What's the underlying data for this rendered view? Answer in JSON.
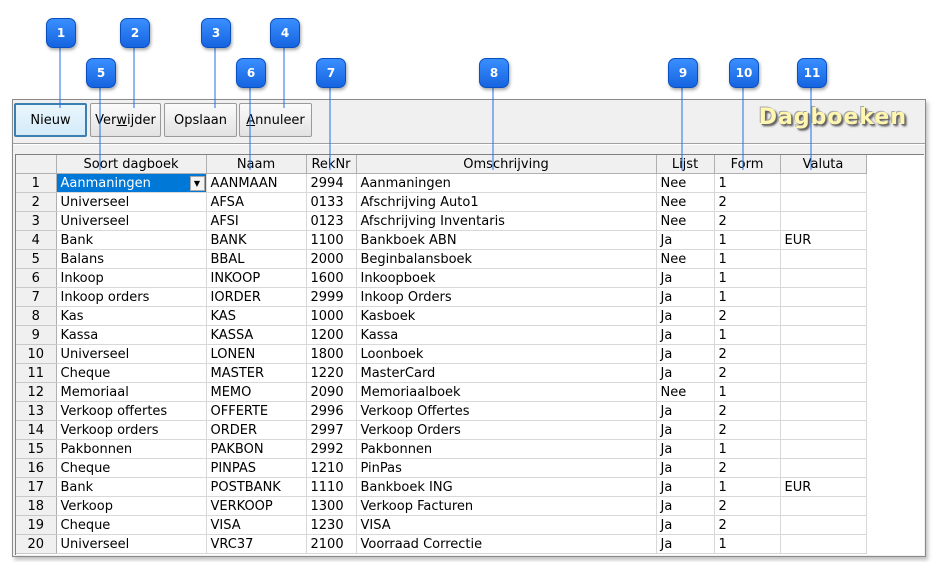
{
  "window_title": "Dagboeken",
  "toolbar": {
    "new_label": "Nieuw",
    "delete_prefix": "Ver",
    "delete_access": "w",
    "delete_suffix": "ijder",
    "save_label": "Opslaan",
    "cancel_access": "A",
    "cancel_suffix": "nnuleer"
  },
  "callouts": [
    "1",
    "2",
    "3",
    "4",
    "5",
    "6",
    "7",
    "8",
    "9",
    "10",
    "11"
  ],
  "columns": [
    "Soort dagboek",
    "Naam",
    "RekNr",
    "Omschrijving",
    "Lijst",
    "Form",
    "Valuta"
  ],
  "rows": [
    {
      "n": "1",
      "soort": "Aanmaningen",
      "naam": "AANMAAN",
      "reknr": "2994",
      "oms": "Aanmaningen",
      "lijst": "Nee",
      "form": "1",
      "valuta": ""
    },
    {
      "n": "2",
      "soort": "Universeel",
      "naam": "AFSA",
      "reknr": "0133",
      "oms": "Afschrijving Auto1",
      "lijst": "Nee",
      "form": "2",
      "valuta": ""
    },
    {
      "n": "3",
      "soort": "Universeel",
      "naam": "AFSI",
      "reknr": "0123",
      "oms": "Afschrijving Inventaris",
      "lijst": "Nee",
      "form": "2",
      "valuta": ""
    },
    {
      "n": "4",
      "soort": "Bank",
      "naam": "BANK",
      "reknr": "1100",
      "oms": "Bankboek ABN",
      "lijst": "Ja",
      "form": "1",
      "valuta": "EUR"
    },
    {
      "n": "5",
      "soort": "Balans",
      "naam": "BBAL",
      "reknr": "2000",
      "oms": "Beginbalansboek",
      "lijst": "Nee",
      "form": "1",
      "valuta": ""
    },
    {
      "n": "6",
      "soort": "Inkoop",
      "naam": "INKOOP",
      "reknr": "1600",
      "oms": "Inkoopboek",
      "lijst": "Ja",
      "form": "1",
      "valuta": ""
    },
    {
      "n": "7",
      "soort": "Inkoop orders",
      "naam": "IORDER",
      "reknr": "2999",
      "oms": "Inkoop Orders",
      "lijst": "Ja",
      "form": "1",
      "valuta": ""
    },
    {
      "n": "8",
      "soort": "Kas",
      "naam": "KAS",
      "reknr": "1000",
      "oms": "Kasboek",
      "lijst": "Ja",
      "form": "2",
      "valuta": ""
    },
    {
      "n": "9",
      "soort": "Kassa",
      "naam": "KASSA",
      "reknr": "1200",
      "oms": "Kassa",
      "lijst": "Ja",
      "form": "1",
      "valuta": ""
    },
    {
      "n": "10",
      "soort": "Universeel",
      "naam": "LONEN",
      "reknr": "1800",
      "oms": "Loonboek",
      "lijst": "Ja",
      "form": "2",
      "valuta": ""
    },
    {
      "n": "11",
      "soort": "Cheque",
      "naam": "MASTER",
      "reknr": "1220",
      "oms": "MasterCard",
      "lijst": "Ja",
      "form": "2",
      "valuta": ""
    },
    {
      "n": "12",
      "soort": "Memoriaal",
      "naam": "MEMO",
      "reknr": "2090",
      "oms": "Memoriaalboek",
      "lijst": "Nee",
      "form": "1",
      "valuta": ""
    },
    {
      "n": "13",
      "soort": "Verkoop offertes",
      "naam": "OFFERTE",
      "reknr": "2996",
      "oms": "Verkoop Offertes",
      "lijst": "Ja",
      "form": "2",
      "valuta": ""
    },
    {
      "n": "14",
      "soort": "Verkoop orders",
      "naam": "ORDER",
      "reknr": "2997",
      "oms": "Verkoop Orders",
      "lijst": "Ja",
      "form": "2",
      "valuta": ""
    },
    {
      "n": "15",
      "soort": "Pakbonnen",
      "naam": "PAKBON",
      "reknr": "2992",
      "oms": "Pakbonnen",
      "lijst": "Ja",
      "form": "1",
      "valuta": ""
    },
    {
      "n": "16",
      "soort": "Cheque",
      "naam": "PINPAS",
      "reknr": "1210",
      "oms": "PinPas",
      "lijst": "Ja",
      "form": "2",
      "valuta": ""
    },
    {
      "n": "17",
      "soort": "Bank",
      "naam": "POSTBANK",
      "reknr": "1110",
      "oms": "Bankboek ING",
      "lijst": "Ja",
      "form": "1",
      "valuta": "EUR"
    },
    {
      "n": "18",
      "soort": "Verkoop",
      "naam": "VERKOOP",
      "reknr": "1300",
      "oms": "Verkoop Facturen",
      "lijst": "Ja",
      "form": "2",
      "valuta": ""
    },
    {
      "n": "19",
      "soort": "Cheque",
      "naam": "VISA",
      "reknr": "1230",
      "oms": "VISA",
      "lijst": "Ja",
      "form": "2",
      "valuta": ""
    },
    {
      "n": "20",
      "soort": "Universeel",
      "naam": "VRC37",
      "reknr": "2100",
      "oms": "Voorraad Correctie",
      "lijst": "Ja",
      "form": "1",
      "valuta": ""
    }
  ],
  "icons": {
    "dropdown": "chevron-down-icon"
  },
  "colors": {
    "callout": "#1f75f0",
    "selection": "#0078d7",
    "title": "#fff7b0"
  }
}
